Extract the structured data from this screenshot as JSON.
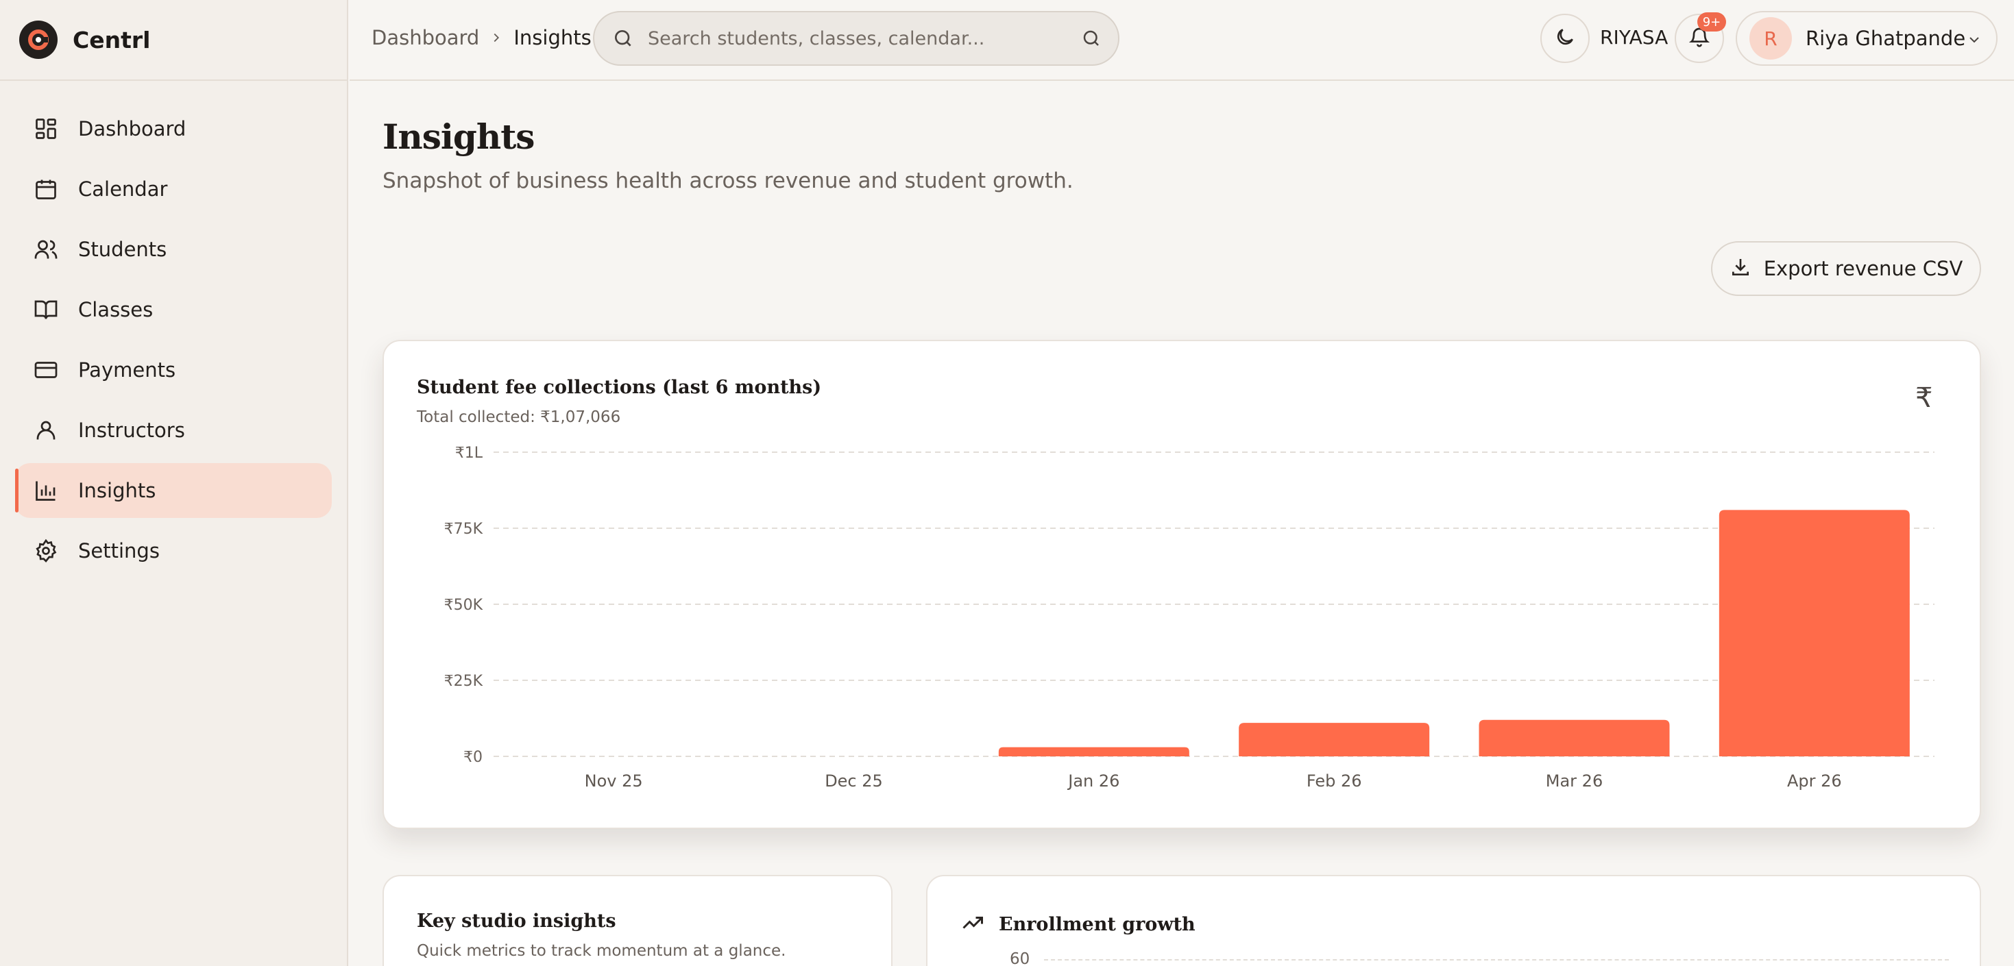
{
  "app": {
    "name": "Centrl"
  },
  "sidebar": {
    "items": [
      {
        "label": "Dashboard",
        "icon": "dashboard-icon"
      },
      {
        "label": "Calendar",
        "icon": "calendar-icon"
      },
      {
        "label": "Students",
        "icon": "users-icon"
      },
      {
        "label": "Classes",
        "icon": "book-icon"
      },
      {
        "label": "Payments",
        "icon": "credit-card-icon"
      },
      {
        "label": "Instructors",
        "icon": "user-icon"
      },
      {
        "label": "Insights",
        "icon": "bar-chart-icon",
        "active": true
      },
      {
        "label": "Settings",
        "icon": "gear-icon"
      }
    ]
  },
  "topbar": {
    "breadcrumb": {
      "home": "Dashboard",
      "current": "Insights"
    },
    "search": {
      "placeholder": "Search students, classes, calendar..."
    },
    "studio": "RIYASA",
    "notifications": "9+",
    "user": {
      "initial": "R",
      "name": "Riya Ghatpande"
    }
  },
  "page": {
    "title": "Insights",
    "subtitle": "Snapshot of business health across revenue and student growth.",
    "export_label": "Export revenue CSV"
  },
  "revenue_card": {
    "title": "Student fee collections (last 6 months)",
    "subtitle": "Total collected: ₹1,07,066",
    "currency_symbol": "₹"
  },
  "insights_card": {
    "title": "Key studio insights",
    "subtitle": "Quick metrics to track momentum at a glance."
  },
  "enroll_card": {
    "title": "Enrollment growth",
    "top_tick": "60"
  },
  "colors": {
    "accent": "#ff6b4a",
    "active_bg": "#f9ddd2"
  },
  "chart_data": {
    "type": "bar",
    "title": "Student fee collections (last 6 months)",
    "categories": [
      "Nov 25",
      "Dec 25",
      "Jan 26",
      "Feb 26",
      "Mar 26",
      "Apr 26"
    ],
    "values": [
      0,
      0,
      3000,
      11000,
      12000,
      81000
    ],
    "y_ticks": [
      0,
      25000,
      50000,
      75000,
      100000
    ],
    "y_tick_labels": [
      "₹0",
      "₹25K",
      "₹50K",
      "₹75K",
      "₹1L"
    ],
    "ylim": [
      0,
      100000
    ],
    "grid": true,
    "color": "#ff6b4a"
  }
}
